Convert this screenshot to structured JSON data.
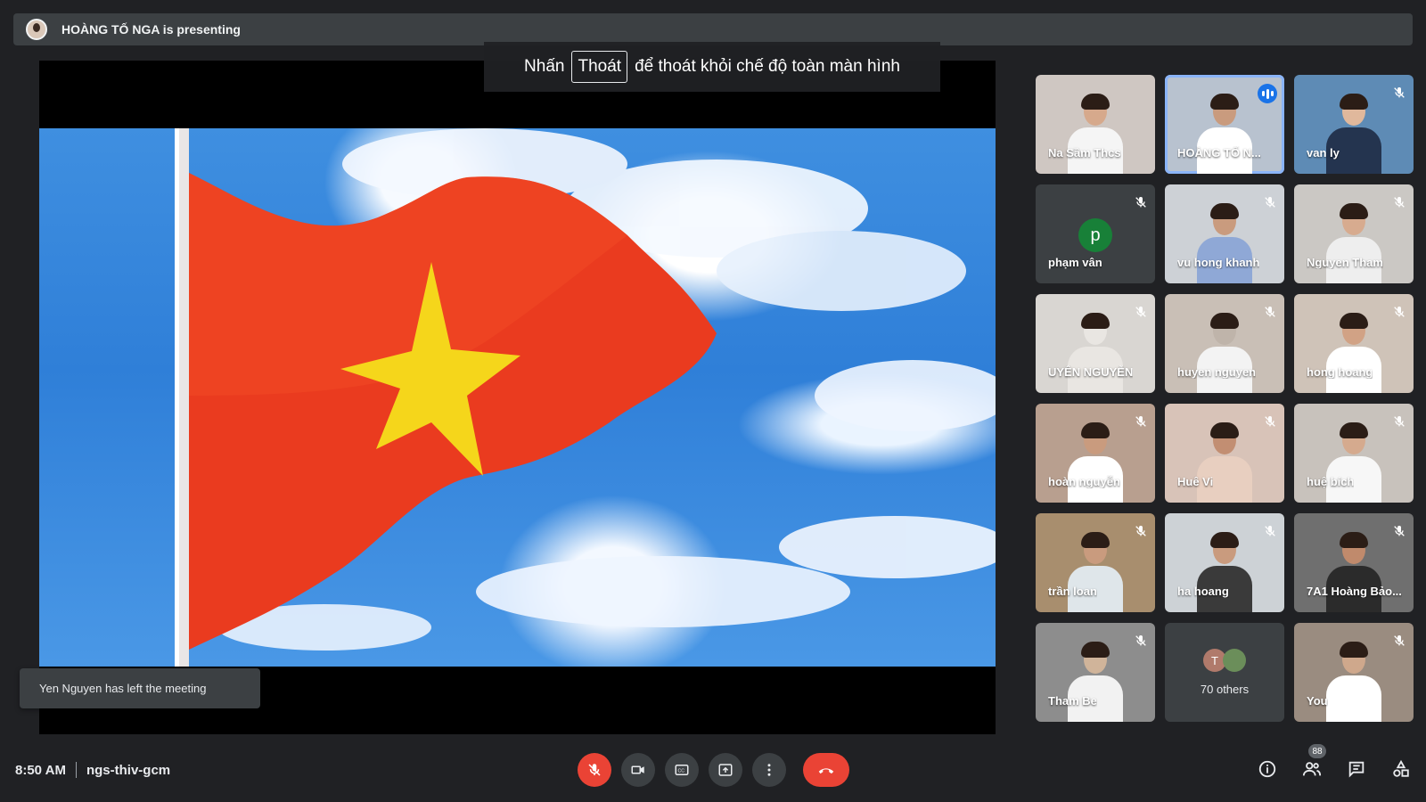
{
  "presenting": {
    "text": "HOÀNG TỐ NGA is presenting"
  },
  "fullscreen_hint": {
    "prefix": "Nhấn",
    "key": "Thoát",
    "suffix": "để thoát khỏi chế độ toàn màn hình"
  },
  "toast": {
    "text": "Yen Nguyen has left the meeting"
  },
  "participants": [
    {
      "name": "Na Sầm Thcs",
      "muted": false,
      "speaking": false,
      "skin": "#d6a98c",
      "shirt": "#f5f5f5",
      "bg": "#cfc7c2"
    },
    {
      "name": "HOÀNG TỐ N...",
      "muted": false,
      "speaking": true,
      "skin": "#c99b7e",
      "shirt": "#ffffff",
      "bg": "#b8c2cf"
    },
    {
      "name": "van ly",
      "muted": true,
      "speaking": false,
      "skin": "#e0b89c",
      "shirt": "#24344f",
      "bg": "#5e8bb5"
    },
    {
      "name": "phạm vân",
      "muted": true,
      "speaking": false,
      "avatar_letter": "p",
      "avatar_color": "#188038"
    },
    {
      "name": "vu hong khanh",
      "muted": true,
      "speaking": false,
      "skin": "#c99b7e",
      "shirt": "#8fa8d6",
      "bg": "#cdd1d6"
    },
    {
      "name": "Nguyen Tham",
      "muted": true,
      "speaking": false,
      "skin": "#d7ab8f",
      "shirt": "#eeeeee",
      "bg": "#cbc8c4"
    },
    {
      "name": "UYÊN NGUYỄN",
      "muted": true,
      "speaking": false,
      "skin": "#e9e6e2",
      "shirt": "#e9e6e2",
      "bg": "#d9d6d2"
    },
    {
      "name": "huyen nguyen",
      "muted": true,
      "speaking": false,
      "skin": "#bfb4aa",
      "shirt": "#f3f3f3",
      "bg": "#c9bfb6"
    },
    {
      "name": "hong hoang",
      "muted": true,
      "speaking": false,
      "skin": "#d1a285",
      "shirt": "#ffffff",
      "bg": "#cfc3b8"
    },
    {
      "name": "hoàn nguyễn",
      "muted": true,
      "speaking": false,
      "skin": "#c99b7e",
      "shirt": "#ffffff",
      "bg": "#b89f8f"
    },
    {
      "name": "Huê Vi",
      "muted": true,
      "speaking": false,
      "skin": "#c28e72",
      "shirt": "#e8cfc0",
      "bg": "#d8c3b8"
    },
    {
      "name": "huệ bích",
      "muted": true,
      "speaking": false,
      "skin": "#d5aa8e",
      "shirt": "#f7f7f7",
      "bg": "#c8c2bc"
    },
    {
      "name": "trần loan",
      "muted": true,
      "speaking": false,
      "skin": "#c99b7e",
      "shirt": "#dfe6ea",
      "bg": "#a88e6e"
    },
    {
      "name": "ha hoang",
      "muted": true,
      "speaking": false,
      "skin": "#c99b7e",
      "shirt": "#3a3a3a",
      "bg": "#cdd2d6"
    },
    {
      "name": "7A1 Hoàng Bảo...",
      "muted": true,
      "speaking": false,
      "skin": "#c08a6c",
      "shirt": "#2b2b2b",
      "bg": "#6f6f6f"
    },
    {
      "name": "Tham Be",
      "muted": true,
      "speaking": false,
      "skin": "#d0b49a",
      "shirt": "#f2f2f2",
      "bg": "#8d8d8d"
    },
    {
      "name": "70 others",
      "others": true,
      "avatar_letter": "T",
      "avatar_color": "#b07a6b"
    },
    {
      "name": "You",
      "muted": true,
      "speaking": false,
      "skin": "#cfa88c",
      "shirt": "#ffffff",
      "bg": "#9a8c80"
    }
  ],
  "bottom": {
    "time": "8:50 AM",
    "meeting_code": "ngs-thiv-gcm"
  },
  "controls": [
    "mic-off-icon",
    "camera-icon",
    "captions-icon",
    "present-icon",
    "more-vert-icon",
    "hangup-icon"
  ],
  "right_icons": {
    "people_count": "88"
  },
  "colors": {
    "background": "#202124",
    "panel": "#3c4043",
    "accent": "#8ab4f8",
    "danger": "#ea4335",
    "active_speaker": "#1a73e8"
  }
}
